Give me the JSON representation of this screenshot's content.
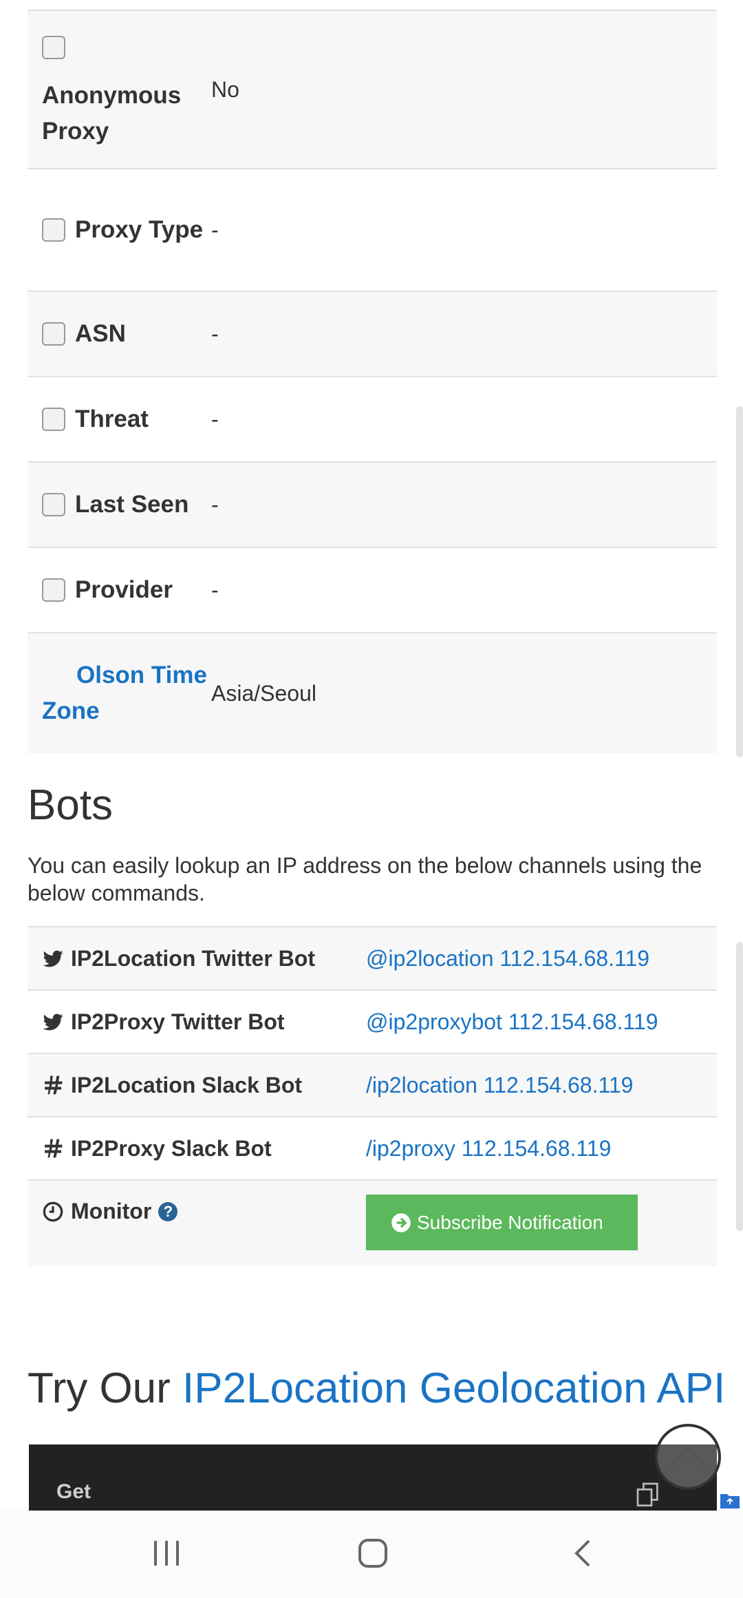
{
  "proxy_rows": [
    {
      "label": "Anonymous Proxy",
      "value": "No"
    },
    {
      "label": "Proxy Type",
      "value": "-"
    },
    {
      "label": "ASN",
      "value": "-"
    },
    {
      "label": "Threat",
      "value": "-"
    },
    {
      "label": "Last Seen",
      "value": "-"
    },
    {
      "label": "Provider",
      "value": "-"
    },
    {
      "label": "Olson Time Zone",
      "value": "Asia/Seoul"
    }
  ],
  "bots": {
    "title": "Bots",
    "description": "You can easily lookup an IP address on the below channels using the below commands.",
    "rows": [
      {
        "icon": "twitter-icon",
        "label": "IP2Location Twitter Bot",
        "command": "@ip2location 112.154.68.119"
      },
      {
        "icon": "twitter-icon",
        "label": "IP2Proxy Twitter Bot",
        "command": "@ip2proxybot 112.154.68.119"
      },
      {
        "icon": "slack-icon",
        "label": "IP2Location Slack Bot",
        "command": "/ip2location 112.154.68.119"
      },
      {
        "icon": "slack-icon",
        "label": "IP2Proxy Slack Bot",
        "command": "/ip2proxy 112.154.68.119"
      }
    ],
    "monitor": {
      "label": "Monitor",
      "help": "?",
      "button": "Subscribe Notification"
    }
  },
  "api": {
    "title_prefix": "Try Our",
    "title_link": "IP2Location Geolocation API",
    "method": "Get"
  },
  "colors": {
    "link": "#1a73c4",
    "button": "#5cb85c",
    "code_bg": "#222222"
  }
}
